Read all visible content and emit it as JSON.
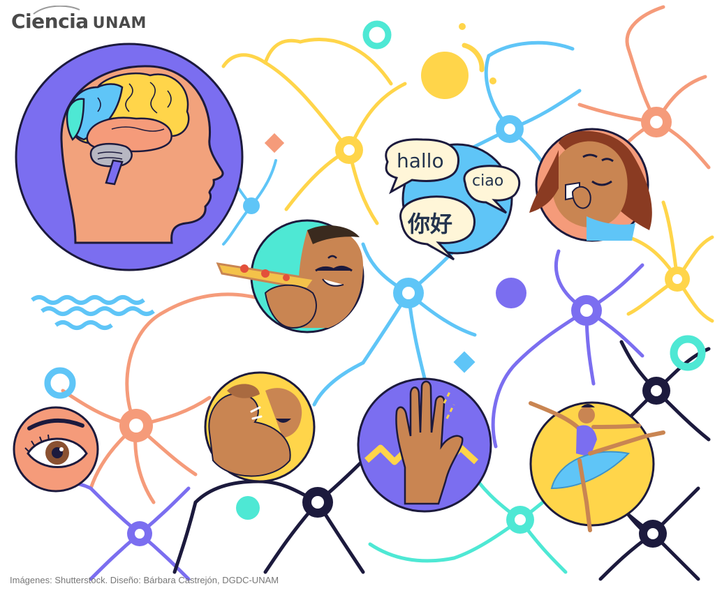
{
  "brand": {
    "name_part1": "Ciencia",
    "name_part2": "UNAM"
  },
  "bubbles": {
    "hallo": "hallo",
    "ciao": "ciao",
    "nihao": "你好"
  },
  "credit": "Imágenes: Shutterstock. Diseño: Bárbara Castrejón, DGDC-UNAM",
  "colors": {
    "purple": "#7b6ef0",
    "salmon": "#f59b7a",
    "yellow": "#ffd54a",
    "sky": "#5fc5f7",
    "teal": "#4ee8d4",
    "navy": "#1c1a3d",
    "skin_light": "#f2a27c",
    "skin_mid": "#c98552",
    "skin_dark": "#8a5131"
  },
  "icons": [
    "brain-in-head-icon",
    "speech-bubbles-icon",
    "pizza-eating-icon",
    "smiling-woman-icon",
    "eye-icon",
    "flexing-arm-icon",
    "hand-icon",
    "ballerina-icon",
    "neuron-icon"
  ]
}
